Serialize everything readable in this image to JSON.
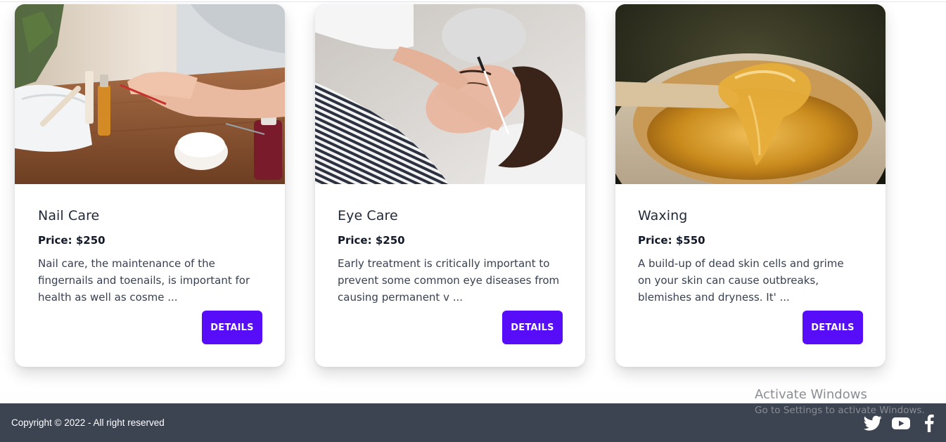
{
  "cards": [
    {
      "title": "Nail Care",
      "price": "Price: $250",
      "description": "Nail care, the maintenance of the fingernails and toenails, is important for health as well as cosme ...",
      "button": "DETAILS",
      "image": "manicure-photo"
    },
    {
      "title": "Eye Care",
      "price": "Price: $250",
      "description": "Early treatment is critically important to prevent some common eye diseases from causing permanent v ...",
      "button": "DETAILS",
      "image": "eyebrow-treatment-photo"
    },
    {
      "title": "Waxing",
      "price": "Price: $550",
      "description": "A build-up of dead skin cells and grime on your skin can cause outbreaks, blemishes and dryness. It' ...",
      "button": "DETAILS",
      "image": "honey-wax-photo"
    }
  ],
  "watermark": {
    "title": "Activate Windows",
    "subtitle": "Go to Settings to activate Windows."
  },
  "footer": {
    "copyright": "Copyright © 2022 - All right reserved",
    "social_icons": [
      "twitter-icon",
      "youtube-icon",
      "facebook-icon"
    ]
  },
  "colors": {
    "primary_button": "#570df8",
    "footer_bg": "#3d4451",
    "title_text": "#1f2937"
  }
}
